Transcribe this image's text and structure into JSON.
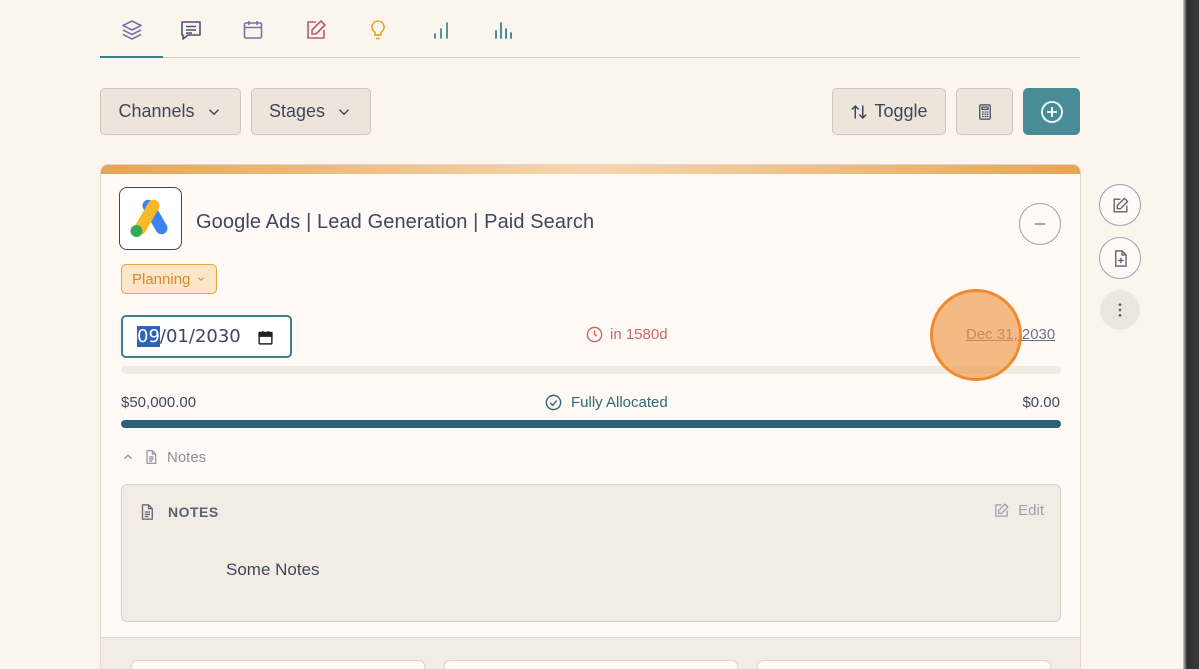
{
  "tabs": [
    {
      "icon": "layers-icon",
      "color": "#7a6fa6",
      "active": true
    },
    {
      "icon": "message-icon",
      "color": "#4a5070"
    },
    {
      "icon": "calendar-icon",
      "color": "#7a6fa6"
    },
    {
      "icon": "edit-icon",
      "color": "#b35c6f"
    },
    {
      "icon": "lightbulb-icon",
      "color": "#e6a02c"
    },
    {
      "icon": "bar-chart-icon",
      "color": "#3d8f8e"
    },
    {
      "icon": "bar-chart-alt-icon",
      "color": "#3d7f8e"
    }
  ],
  "toolbar": {
    "channels_label": "Channels",
    "stages_label": "Stages",
    "toggle_label": "Toggle",
    "calculator_icon": "calculator-icon",
    "add_icon": "plus-circle-icon"
  },
  "campaign": {
    "logo": "google-ads-logo",
    "title": "Google Ads | Lead Generation | Paid Search",
    "stage": "Planning",
    "start_date_selected": "09",
    "start_date_rest": "/01/2030",
    "countdown": "in 1580d",
    "end_date": "Dec 31, 2030",
    "budget_amount": "$50,000.00",
    "budget_status": "Fully Allocated",
    "budget_remaining": "$0.00",
    "budget_allocated_fraction": 1.0
  },
  "notes": {
    "toggle_label": "Notes",
    "heading": "NOTES",
    "edit_label": "Edit",
    "body": "Some Notes"
  },
  "colors": {
    "accent": "#4a8b98",
    "stage_badge": "#e6a548",
    "budget_bar": "#2b627a",
    "countdown": "#c96a67"
  }
}
